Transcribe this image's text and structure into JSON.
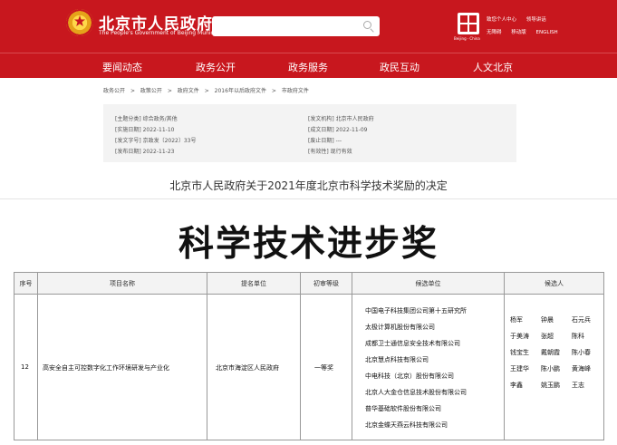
{
  "header": {
    "site_title": "北京市人民政府",
    "site_subtitle": "The People's Government of Beijing Municipality",
    "search_placeholder": "",
    "beijing_logo_caption": "Beijing · China",
    "links_row1": [
      "致您个人中心",
      "领导讲话"
    ],
    "links_row2": [
      "无障碍",
      "移动版",
      "ENGLISH"
    ],
    "brand_color": "#c8171e"
  },
  "nav": [
    "要闻动态",
    "政务公开",
    "政务服务",
    "政民互动",
    "人文北京"
  ],
  "breadcrumb": [
    "政务公开",
    ">",
    "政策公开",
    ">",
    "政府文件",
    ">",
    "2016年以后政府文件",
    ">",
    "市政府文件"
  ],
  "info": {
    "topic": "[主题分类] 综合政务/其他",
    "impl_date": "[实施日期] 2022-11-10",
    "doc_no": "[发文字号] 京政发〔2022〕33号",
    "pub_date": "[发布日期] 2022-11-23",
    "issuer": "[发文机构] 北京市人民政府",
    "written_date": "[成文日期] 2022-11-09",
    "abolish_date": "[废止日期] ---",
    "validity": "[有效性] 现行有效"
  },
  "doc_title": "北京市人民政府关于2021年度北京市科学技术奖励的决定",
  "award_heading": "科学技术进步奖",
  "table": {
    "headers": [
      "序号",
      "项目名称",
      "提名单位",
      "初审等级",
      "候选单位",
      "候选人"
    ],
    "row": {
      "no": "12",
      "project": "高安全自主可控数字化工作环境研发与产业化",
      "nominator": "北京市海淀区人民政府",
      "level": "一等奖",
      "units": [
        "中国电子科技集团公司第十五研究所",
        "太极计算机股份有限公司",
        "成都卫士通信息安全技术有限公司",
        "北京慧点科技有限公司",
        "中电科技（北京）股份有限公司",
        "北京人大金仓信息技术股份有限公司",
        "普华基础软件股份有限公司",
        "北京金蝶天燕云科技有限公司"
      ],
      "persons": [
        [
          "杨军",
          "钟晨",
          "石元兵"
        ],
        [
          "于美涛",
          "张超",
          "陈科"
        ],
        [
          "钱宝生",
          "戴朝霞",
          "陈小春"
        ],
        [
          "王建华",
          "陈小鹏",
          "黄海峰"
        ],
        [
          "李鑫",
          "姚玉鹏",
          "王志"
        ]
      ]
    }
  }
}
